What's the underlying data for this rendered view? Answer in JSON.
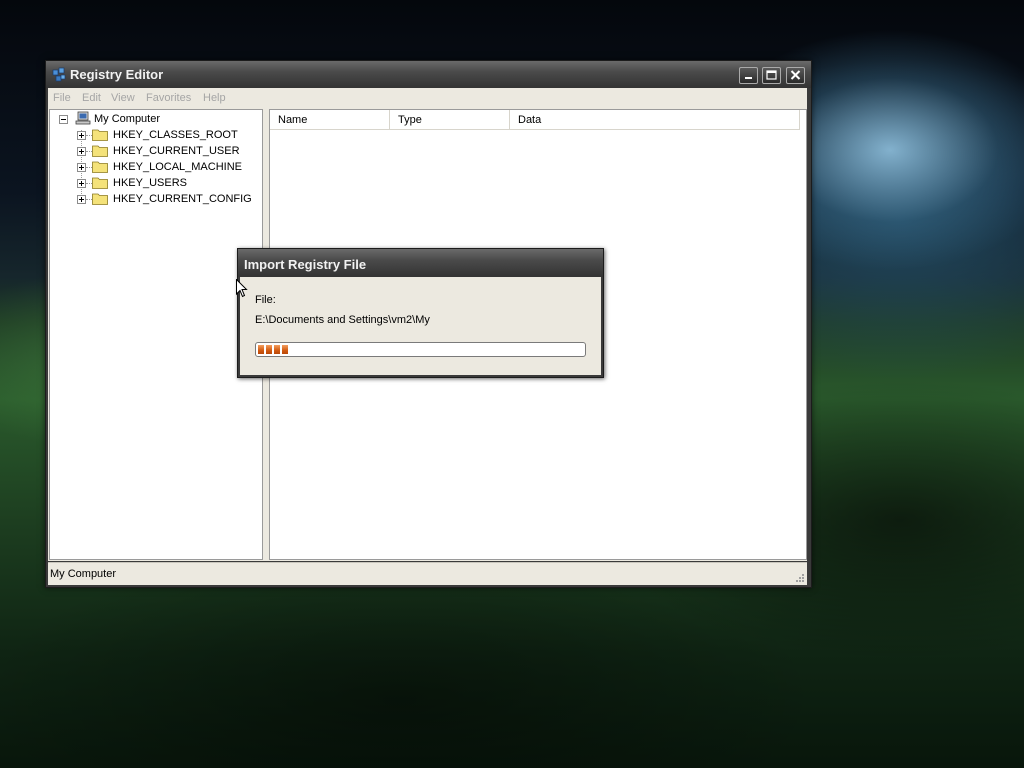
{
  "window": {
    "title": "Registry Editor",
    "menu": [
      "File",
      "Edit",
      "View",
      "Favorites",
      "Help"
    ]
  },
  "tree": {
    "root": "My Computer",
    "keys": [
      "HKEY_CLASSES_ROOT",
      "HKEY_CURRENT_USER",
      "HKEY_LOCAL_MACHINE",
      "HKEY_USERS",
      "HKEY_CURRENT_CONFIG"
    ]
  },
  "list": {
    "columns": [
      "Name",
      "Type",
      "Data"
    ]
  },
  "status": {
    "text": "My Computer"
  },
  "dialog": {
    "title": "Import Registry File",
    "file_label": "File:",
    "file_path": "E:\\Documents and Settings\\vm2\\My",
    "progress_fraction": 0.1
  },
  "colors": {
    "progress": "#d25a10",
    "titlebar": "#4a4a4a"
  }
}
